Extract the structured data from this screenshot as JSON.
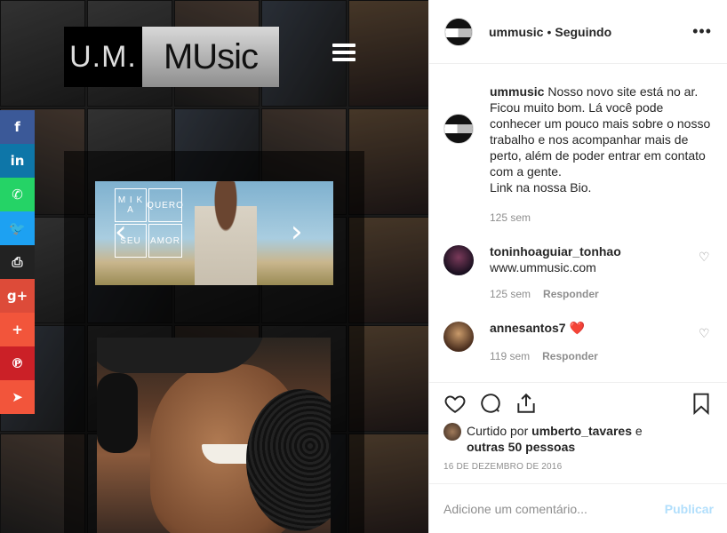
{
  "media": {
    "logo_left": "U.M.",
    "logo_right": "MUsic",
    "banner_cells": [
      "M I K A",
      "QUERO",
      "SEU",
      "AMOR"
    ],
    "banner_prev": "‹",
    "banner_next": "›"
  },
  "share_bar": [
    {
      "name": "facebook",
      "glyph": "f",
      "color": "#3b5998"
    },
    {
      "name": "linkedin",
      "glyph": "in",
      "color": "#0e76a8"
    },
    {
      "name": "whatsapp",
      "glyph": "✆",
      "color": "#25d366"
    },
    {
      "name": "twitter",
      "glyph": "🐦",
      "color": "#1da1f2"
    },
    {
      "name": "print",
      "glyph": "⎙",
      "color": "#222222"
    },
    {
      "name": "googleplus",
      "glyph": "g+",
      "color": "#dd4b39"
    },
    {
      "name": "more",
      "glyph": "+",
      "color": "#f2553b"
    },
    {
      "name": "pinterest",
      "glyph": "℗",
      "color": "#cb2027"
    },
    {
      "name": "telegram",
      "glyph": "➤",
      "color": "#f2553b"
    }
  ],
  "header": {
    "username": "ummusic",
    "separator": "•",
    "follow_status": "Seguindo",
    "more_icon": "•••"
  },
  "caption": {
    "username": "ummusic",
    "text": "Nosso novo site está no ar. Ficou muito bom. Lá você pode conhecer um pouco mais sobre o nosso trabalho e nos acompanhar mais de perto, além de poder entrar em contato com a gente.",
    "text2": "Link na nossa Bio.",
    "time": "125 sem"
  },
  "comments": [
    {
      "username": "toninhoaguiar_tonhao",
      "text": "www.ummusic.com",
      "time": "125 sem",
      "reply": "Responder"
    },
    {
      "username": "annesantos7",
      "text": "❤️",
      "time": "119 sem",
      "reply": "Responder"
    }
  ],
  "likes": {
    "prefix": "Curtido por",
    "user": "umberto_tavares",
    "conj": "e",
    "others": "outras 50 pessoas"
  },
  "date": "16 DE DEZEMBRO DE 2016",
  "add_comment": {
    "placeholder": "Adicione um comentário...",
    "post_label": "Publicar"
  },
  "colors": {
    "text": "#262626",
    "muted": "#8e8e8e",
    "post_disabled": "#b2dffc",
    "heart": "#ed4956"
  }
}
